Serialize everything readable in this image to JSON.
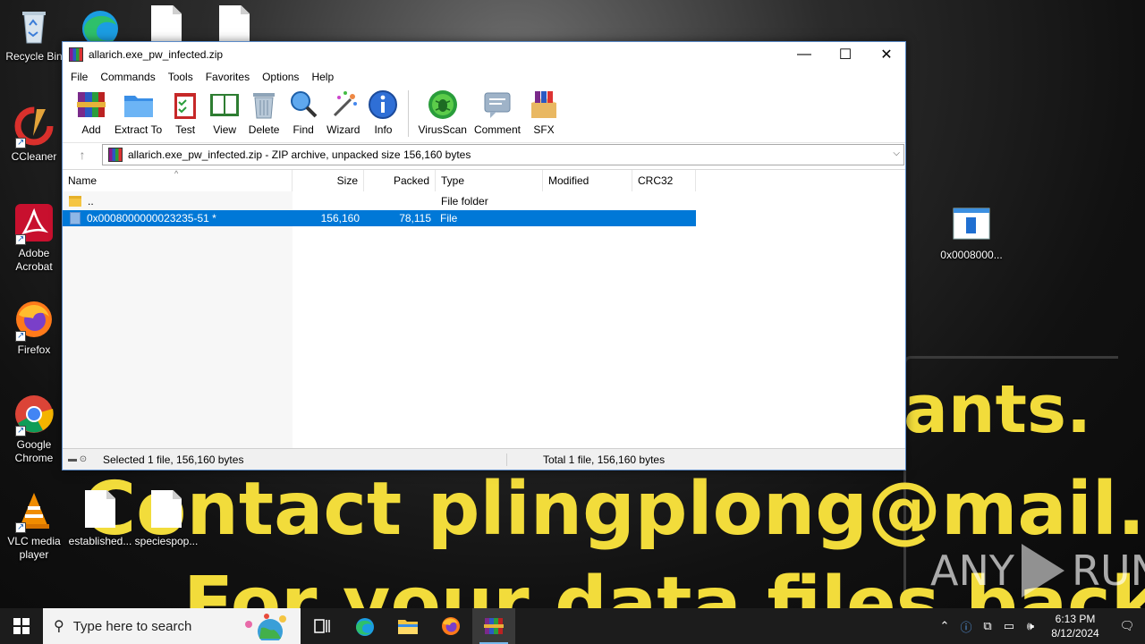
{
  "desktop": {
    "wallpaper_lines": [
      "ants.",
      "Contact plingplong@mail.com",
      "For your data files back!"
    ],
    "watermark": {
      "left": "ANY",
      "right": "RUN"
    },
    "icons": [
      {
        "label": "Recycle Bin"
      },
      {
        "label": "CCleaner"
      },
      {
        "label": "Adobe Acrobat"
      },
      {
        "label": "Firefox"
      },
      {
        "label": "Google Chrome"
      },
      {
        "label": "VLC media player"
      },
      {
        "label": "established..."
      },
      {
        "label": "speciespop..."
      },
      {
        "label": "0x0008000..."
      }
    ]
  },
  "window": {
    "title": "allarich.exe_pw_infected.zip",
    "controls": {
      "minimize": "—",
      "maximize": "☐",
      "close": "✕"
    },
    "menu": [
      "File",
      "Commands",
      "Tools",
      "Favorites",
      "Options",
      "Help"
    ],
    "toolbar": [
      "Add",
      "Extract To",
      "Test",
      "View",
      "Delete",
      "Find",
      "Wizard",
      "Info",
      "VirusScan",
      "Comment",
      "SFX"
    ],
    "address": "allarich.exe_pw_infected.zip - ZIP archive, unpacked size 156,160 bytes",
    "columns": [
      "Name",
      "Size",
      "Packed",
      "Type",
      "Modified",
      "CRC32"
    ],
    "rows": [
      {
        "name": "..",
        "size": "",
        "packed": "",
        "type": "File folder",
        "modified": "",
        "crc": ""
      },
      {
        "name": "0x0008000000023235-51 *",
        "size": "156,160",
        "packed": "78,115",
        "type": "File",
        "modified": "",
        "crc": ""
      }
    ],
    "status": {
      "left": "Selected 1 file, 156,160 bytes",
      "right": "Total 1 file, 156,160 bytes"
    }
  },
  "taskbar": {
    "search_placeholder": "Type here to search",
    "time": "6:13 PM",
    "date": "8/12/2024"
  },
  "colors": {
    "accent": "#0078d7",
    "taskbar": "#1c1c1c",
    "wallpaper_text": "#f2dc3b"
  }
}
